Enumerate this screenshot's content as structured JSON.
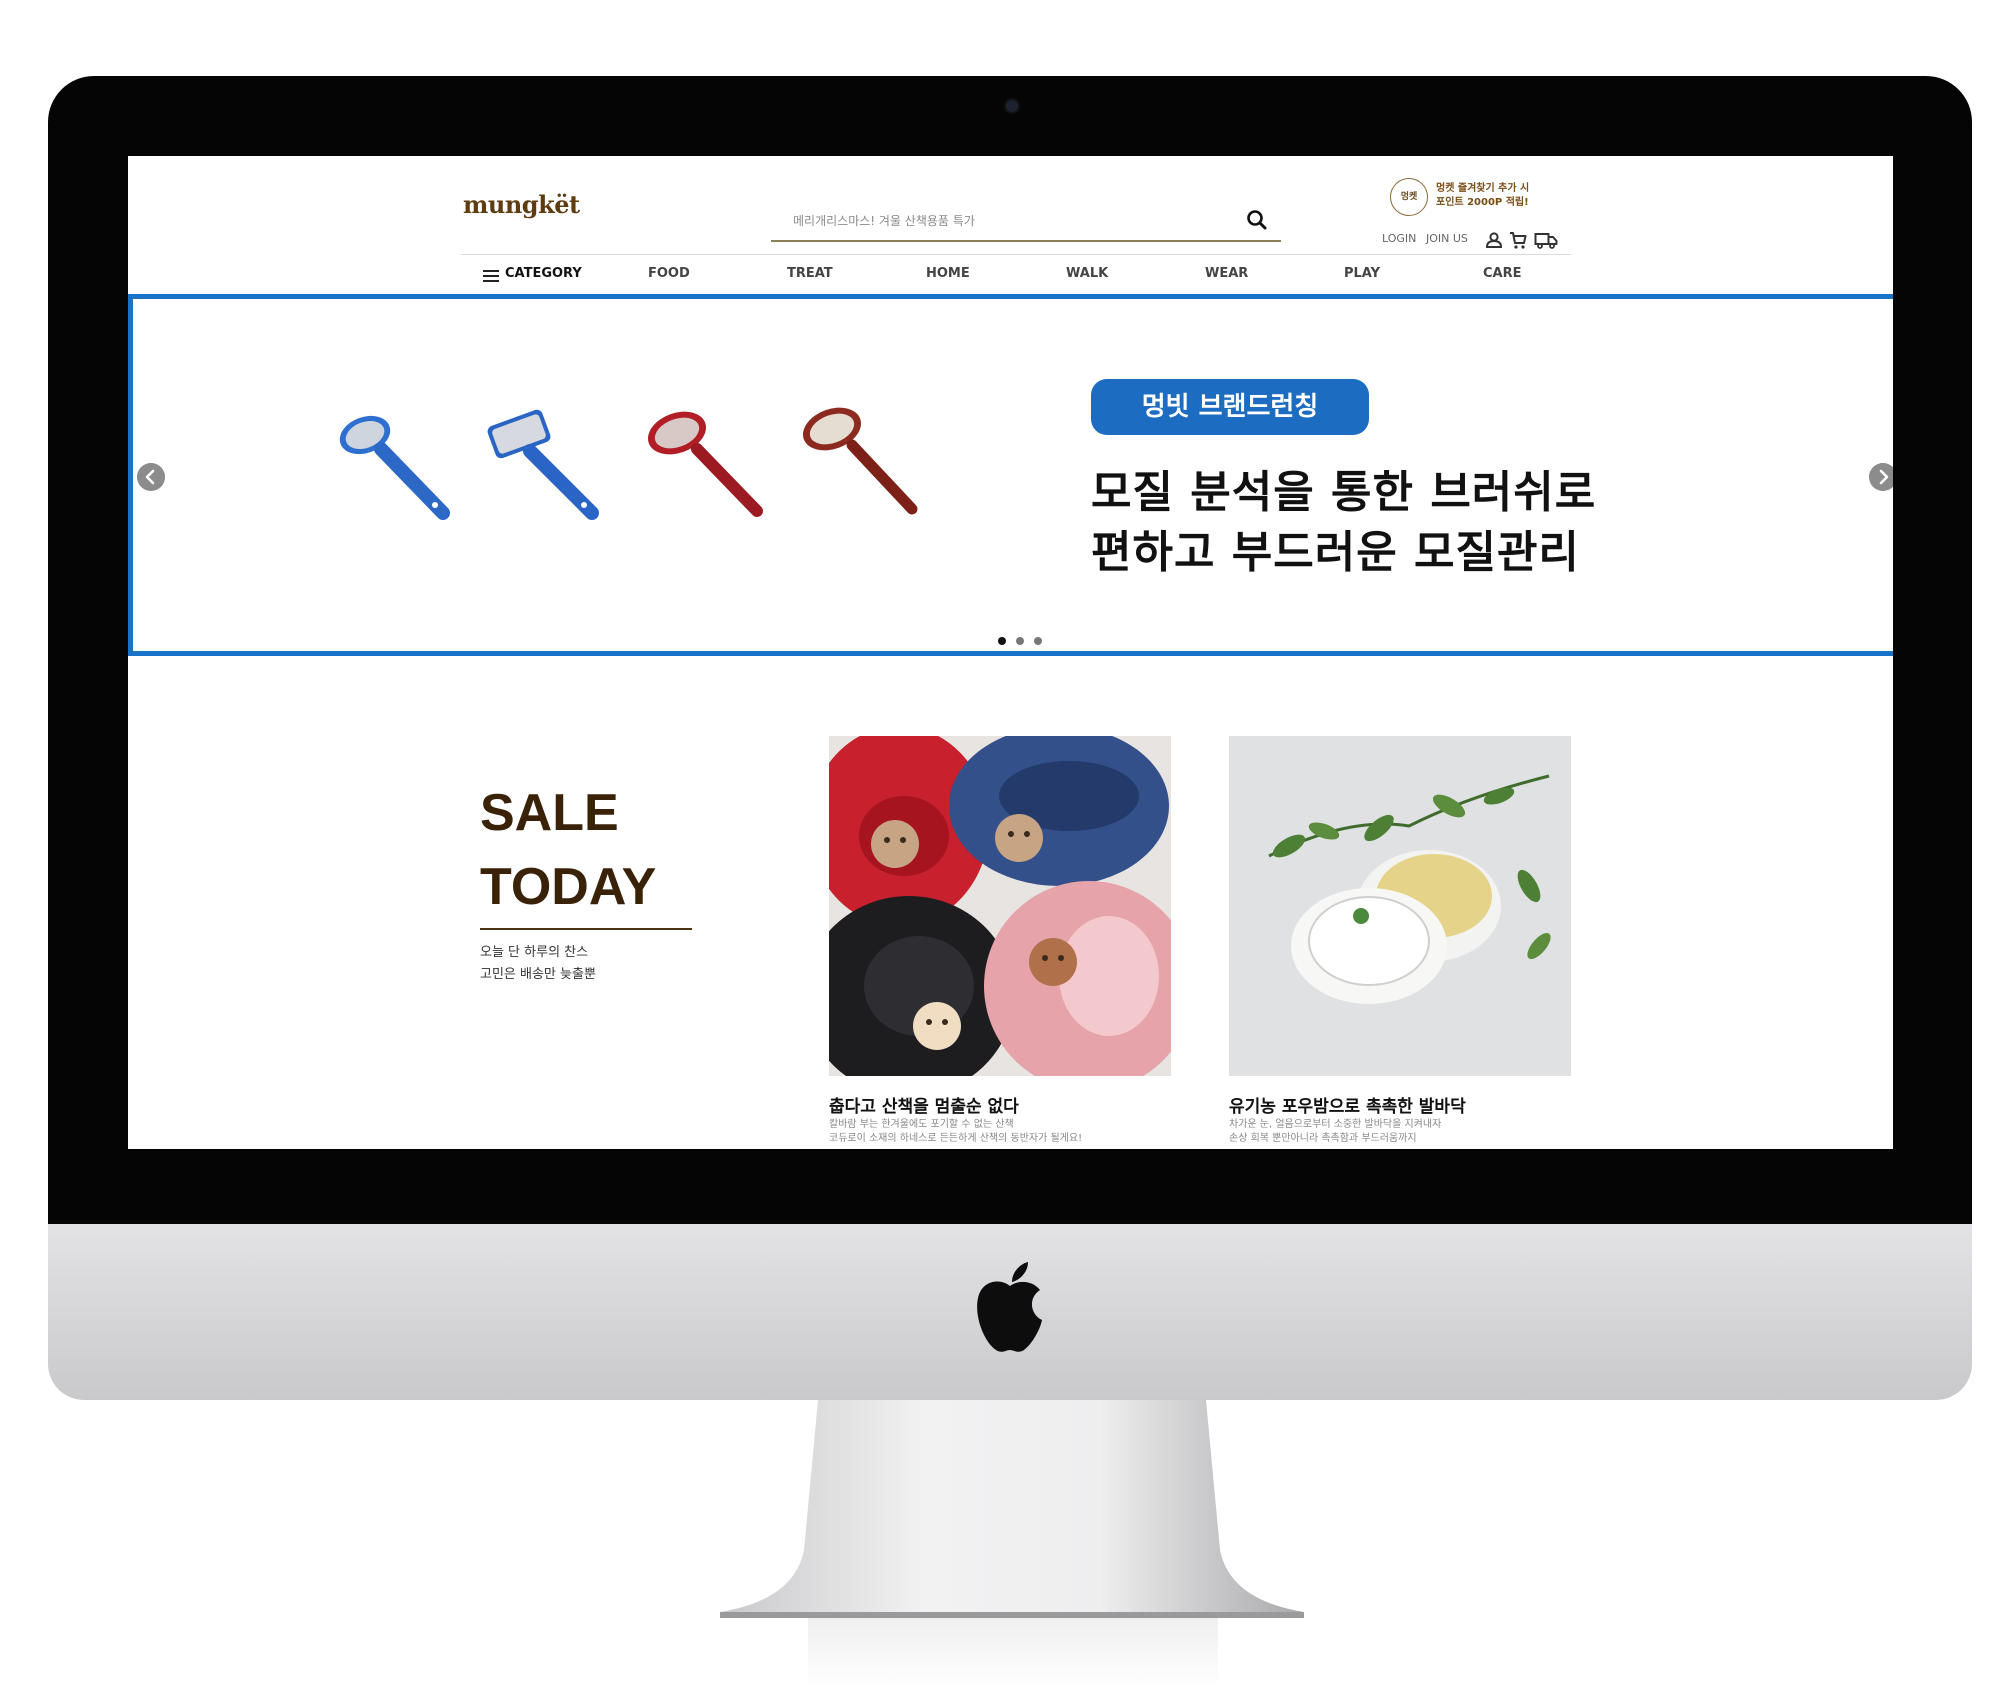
{
  "header": {
    "logo": "mungkët",
    "search_placeholder": "메리개리스마스! 겨울 산책용품 특가",
    "promo_badge": "멍켓",
    "promo_line1": "멍켓 즐겨찾기 추가 시",
    "promo_line2": "포인트 2000P 적립!",
    "login": "LOGIN",
    "join": "JOIN US"
  },
  "nav": {
    "category": "CATEGORY",
    "items": [
      "FOOD",
      "TREAT",
      "HOME",
      "WALK",
      "WEAR",
      "PLAY",
      "CARE"
    ]
  },
  "banner": {
    "tag": "멍빗 브랜드런칭",
    "line1": "모질 분석을 통한 브러쉬로",
    "line2": "편하고 부드러운 모질관리"
  },
  "sale": {
    "title1": "SALE",
    "title2": "TODAY",
    "sub1": "오늘 단 하루의 찬스",
    "sub2": "고민은 배송만 늦출뿐"
  },
  "cards": [
    {
      "title": "춥다고 산책을 멈출순 없다",
      "desc1": "칼바람 부는 한겨울에도 포기할 수 없는 산책",
      "desc2": "코듀로이 소재의 하네스로 든든하게 산책의 동반자가 될게요!"
    },
    {
      "title": "유기농 포우밤으로 촉촉한 발바닥",
      "desc1": "차가운 눈, 얼음으로부터 소중한 발바닥을 지켜내자",
      "desc2": "손상 회복 뿐만아니라 촉촉함과 부드러움까지"
    }
  ],
  "colors": {
    "accent_blue": "#1872c8",
    "brand_brown": "#5e3c10",
    "sale_brown": "#3a2208"
  }
}
